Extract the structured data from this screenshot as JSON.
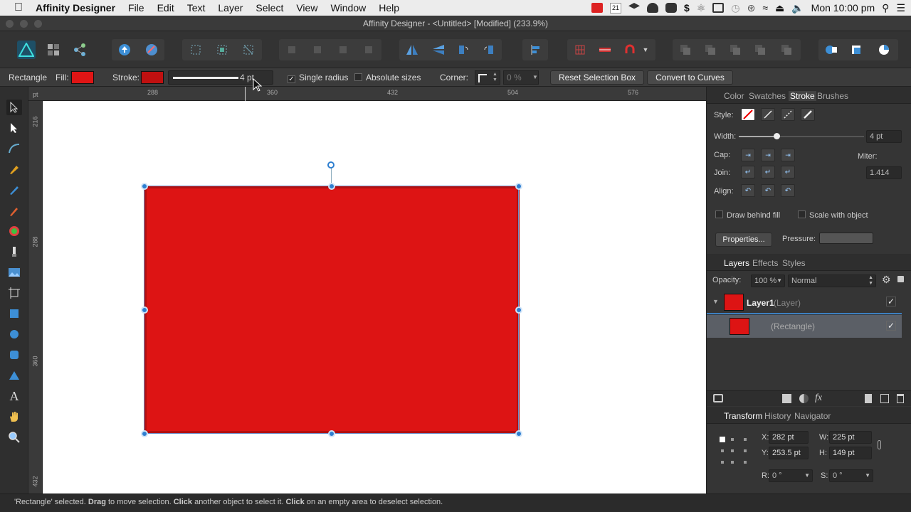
{
  "menubar": {
    "apple": "",
    "app_name": "Affinity Designer",
    "items": [
      "File",
      "Edit",
      "Text",
      "Layer",
      "Select",
      "View",
      "Window",
      "Help"
    ],
    "calendar_day": "21",
    "clock": "Mon 10:00 pm"
  },
  "window": {
    "title": "Affinity Designer - <Untitled> [Modified] (233.9%)"
  },
  "context": {
    "tool_name": "Rectangle",
    "fill_label": "Fill:",
    "fill_color": "#e01515",
    "stroke_label": "Stroke:",
    "stroke_color": "#c01010",
    "stroke_width": "4 pt",
    "single_radius": "Single radius",
    "single_radius_checked": true,
    "absolute_sizes": "Absolute sizes",
    "corner_label": "Corner:",
    "corner_value": "0 %",
    "reset_button": "Reset Selection Box",
    "convert_button": "Convert to Curves"
  },
  "rulers": {
    "unit": "pt",
    "h_ticks": [
      "288",
      "360",
      "432",
      "504",
      "576"
    ],
    "v_ticks": [
      "216",
      "288",
      "360",
      "432"
    ]
  },
  "stroke_panel": {
    "tabs": [
      "Color",
      "Swatches",
      "Stroke",
      "Brushes"
    ],
    "active_tab": "Stroke",
    "style_label": "Style:",
    "width_label": "Width:",
    "width_value": "4 pt",
    "width_slider": 0.3,
    "cap_label": "Cap:",
    "join_label": "Join:",
    "align_label": "Align:",
    "miter_label": "Miter:",
    "miter_value": "1.414",
    "draw_behind_fill": "Draw behind fill",
    "scale_with_object": "Scale with object",
    "properties_button": "Properties...",
    "pressure_label": "Pressure:"
  },
  "layers_panel": {
    "tabs": [
      "Layers",
      "Effects",
      "Styles"
    ],
    "active_tab": "Layers",
    "opacity_label": "Opacity:",
    "opacity_value": "100 %",
    "blend_mode": "Normal",
    "layers": [
      {
        "name": "Layer1",
        "type": "(Layer)",
        "visible": true
      },
      {
        "name": "",
        "type": "(Rectangle)",
        "visible": true
      }
    ]
  },
  "transform_panel": {
    "tabs": [
      "Transform",
      "History",
      "Navigator"
    ],
    "active_tab": "Transform",
    "x_label": "X:",
    "x_value": "282 pt",
    "y_label": "Y:",
    "y_value": "253.5 pt",
    "w_label": "W:",
    "w_value": "225 pt",
    "h_label": "H:",
    "h_value": "149 pt",
    "r_label": "R:",
    "r_value": "0 °",
    "s_label": "S:",
    "s_value": "0 °"
  },
  "status": {
    "p1": "'Rectangle' selected. ",
    "b1": "Drag",
    "p2": " to move selection. ",
    "b2": "Click",
    "p3": " another object to select it. ",
    "b3": "Click",
    "p4": " on an empty area to deselect selection."
  },
  "colors": {
    "accent": "#2f7fd0",
    "shape_fill": "#dd1414",
    "shape_stroke": "#b31010"
  }
}
